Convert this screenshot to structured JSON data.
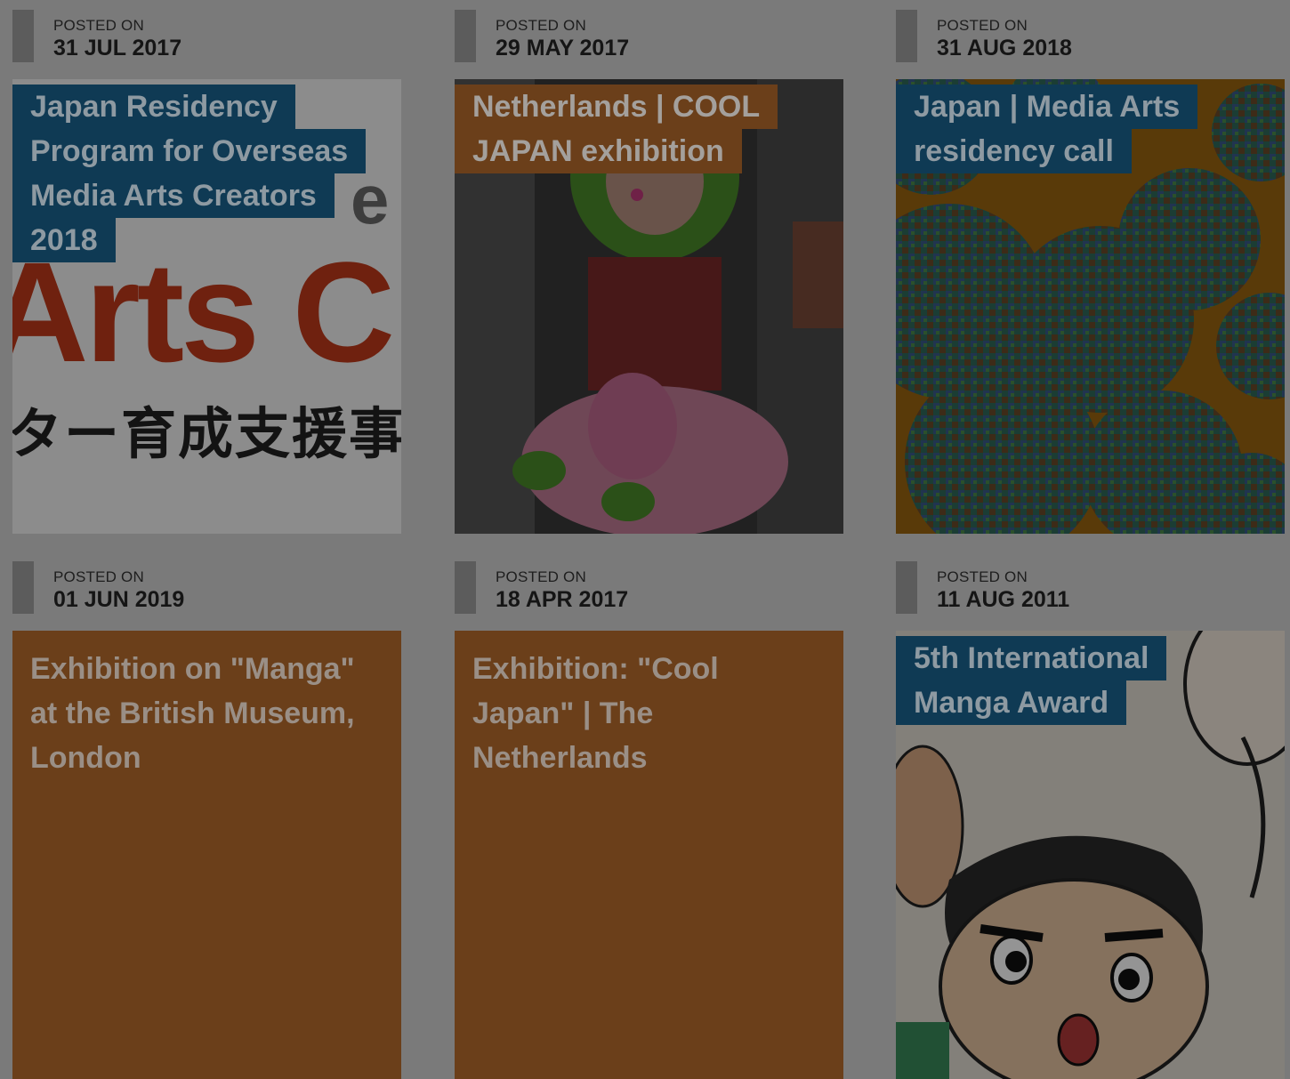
{
  "posts": [
    {
      "posted_label": "POSTED ON",
      "date": "31 JUL 2017",
      "title_lines": [
        "Japan Residency",
        "Program for Overseas",
        "Media Arts Creators",
        "2018"
      ],
      "image_text_big": "Arts C",
      "image_text_partial": "e",
      "image_text_jp": "ター育成支援事業"
    },
    {
      "posted_label": "POSTED ON",
      "date": "29 MAY 2017",
      "title_lines": [
        "Netherlands | COOL",
        "JAPAN exhibition"
      ]
    },
    {
      "posted_label": "POSTED ON",
      "date": "31 AUG 2018",
      "title_lines": [
        "Japan | Media Arts",
        "residency call"
      ]
    },
    {
      "posted_label": "POSTED ON",
      "date": "01 JUN 2019",
      "title_lines": [
        "Exhibition on \"Manga\"",
        "at the British Museum,",
        "London"
      ]
    },
    {
      "posted_label": "POSTED ON",
      "date": "18 APR 2017",
      "title_lines": [
        "Exhibition: \"Cool",
        "Japan\" | The",
        "Netherlands"
      ]
    },
    {
      "posted_label": "POSTED ON",
      "date": "11 AUG 2011",
      "title_lines": [
        "5th International",
        "Manga Award"
      ]
    }
  ],
  "colors": {
    "overlay": "#7a7a7a",
    "title_blue": "#0f3a54",
    "title_orange": "#6b3f1a",
    "card_orange": "#6b3f1a",
    "accent_red": "#c0391b"
  }
}
